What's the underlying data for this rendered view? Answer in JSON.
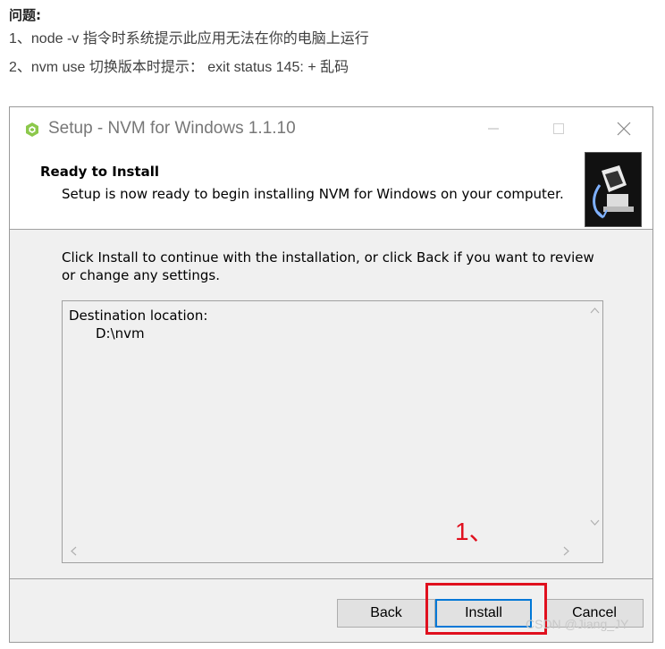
{
  "article": {
    "heading": "问题:",
    "lines": [
      "1、node -v 指令时系统提示此应用无法在你的电脑上运行",
      "2、nvm use 切换版本时提示： exit status 145: + 乱码"
    ]
  },
  "window": {
    "title": "Setup - NVM for Windows 1.1.10",
    "header": {
      "title": "Ready to Install",
      "subtitle": "Setup is now ready to begin installing NVM for Windows on your computer."
    },
    "instructions": "Click Install to continue with the installation, or click Back if you want to review or change any settings.",
    "memo": {
      "label": "Destination location:",
      "path": "D:\\nvm"
    },
    "buttons": {
      "back": "Back",
      "install": "Install",
      "cancel": "Cancel"
    }
  },
  "annotation": {
    "text": "1、",
    "color": "#e0101e"
  },
  "watermark": "CSDN @Jiang_JY",
  "icons": [
    "nvm-app-icon",
    "minimize-icon",
    "maximize-icon",
    "close-icon",
    "installer-wizard-image",
    "scroll-up-arrow-icon",
    "scroll-down-arrow-icon",
    "scroll-left-arrow-icon",
    "scroll-right-arrow-icon"
  ]
}
